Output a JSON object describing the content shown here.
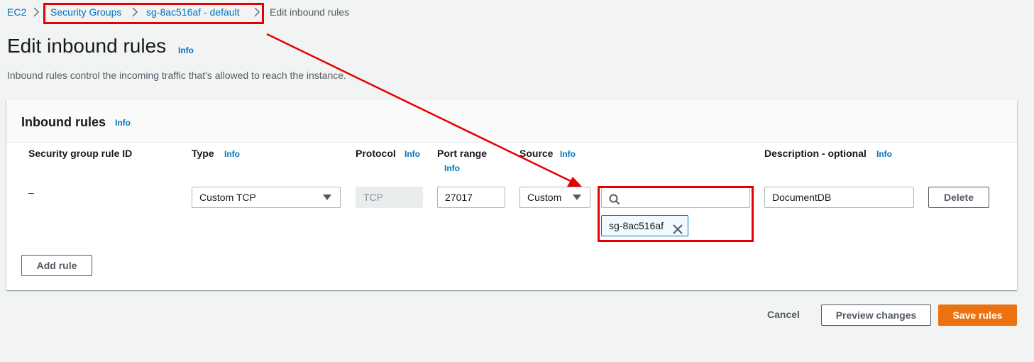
{
  "breadcrumb": {
    "items": [
      "EC2",
      "Security Groups",
      "sg-8ac516af - default"
    ],
    "current": "Edit inbound rules"
  },
  "header": {
    "title": "Edit inbound rules",
    "info": "Info",
    "description": "Inbound rules control the incoming traffic that's allowed to reach the instance."
  },
  "panel": {
    "title": "Inbound rules",
    "info": "Info",
    "columns": {
      "rule_id": "Security group rule ID",
      "type": "Type",
      "type_info": "Info",
      "protocol": "Protocol",
      "protocol_info": "Info",
      "port_range": "Port range",
      "port_range_info": "Info",
      "source": "Source",
      "source_info": "Info",
      "description": "Description - optional",
      "description_info": "Info"
    },
    "row": {
      "rule_id": "–",
      "type": "Custom TCP",
      "protocol": "TCP",
      "port_range": "27017",
      "source_type": "Custom",
      "source_search_value": "",
      "source_token": "sg-8ac516af",
      "description": "DocumentDB",
      "delete_label": "Delete"
    },
    "add_rule_label": "Add rule"
  },
  "footer": {
    "cancel_label": "Cancel",
    "preview_label": "Preview changes",
    "save_label": "Save rules"
  },
  "annotation": {
    "color": "#e60000"
  }
}
